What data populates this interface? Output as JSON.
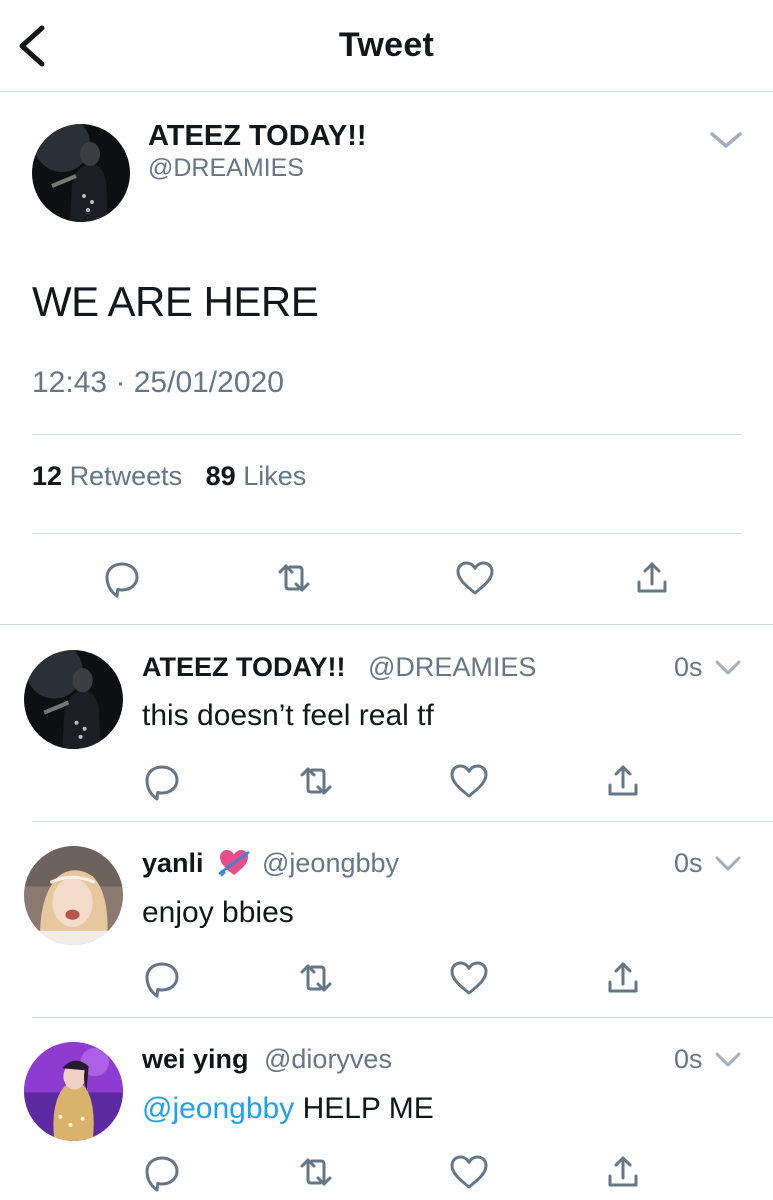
{
  "header": {
    "title": "Tweet",
    "back_icon": "chevron-left-icon"
  },
  "tweet": {
    "author_name": "ATEEZ TODAY!!",
    "author_handle": "@DREAMIES",
    "text": "WE ARE HERE",
    "timestamp": "12:43 · 25/01/2020",
    "retweet_count": "12",
    "retweet_label": "Retweets",
    "like_count": "89",
    "like_label": "Likes"
  },
  "replies": [
    {
      "name": "ATEEZ TODAY!!",
      "handle": "@DREAMIES",
      "time": "0s",
      "text": "this doesn’t feel real tf"
    },
    {
      "name": "yanli",
      "emoji": "heart-with-arrow-emoji",
      "handle": "@jeongbby",
      "time": "0s",
      "text": "enjoy bbies"
    },
    {
      "name": "wei ying",
      "handle": "@dioryves",
      "time": "0s",
      "mention": "@jeongbby",
      "text": " HELP ME"
    }
  ],
  "colors": {
    "accent": "#1da1f2",
    "secondary_text": "#657786",
    "icon": "#657786",
    "divider": "#d4d9dd"
  }
}
